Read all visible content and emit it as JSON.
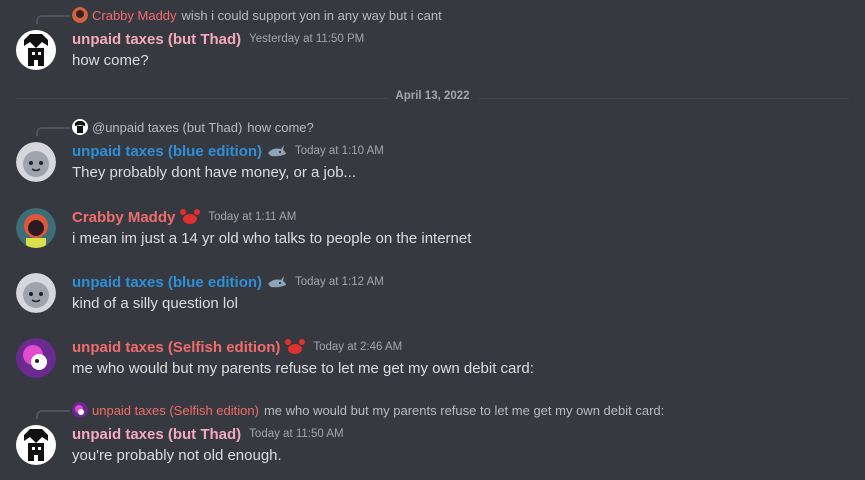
{
  "messages": [
    {
      "reply": {
        "author": "Crabby Maddy",
        "text": "wish i could support yon in any way but i cant"
      },
      "author": "unpaid taxes (but Thad)",
      "timestamp": "Yesterday at 11:50 PM",
      "content": "how come?"
    },
    {
      "reply": {
        "author": "@unpaid taxes (but Thad)",
        "text": "how come?"
      },
      "author": "unpaid taxes (blue edition)",
      "timestamp": "Today at 1:10 AM",
      "content": "They probably dont have money, or a job..."
    },
    {
      "author": "Crabby Maddy",
      "timestamp": "Today at 1:11 AM",
      "content": "i mean im just a 14 yr old who talks to people on the internet"
    },
    {
      "author": "unpaid taxes (blue edition)",
      "timestamp": "Today at 1:12 AM",
      "content": "kind of a silly question lol"
    },
    {
      "author": "unpaid taxes (Selfish edition)",
      "timestamp": "Today at 2:46 AM",
      "content": "me who would but my parents refuse to let me get my own debit card:"
    },
    {
      "reply": {
        "author": "unpaid taxes (Selfish edition)",
        "text": "me who would but my parents refuse to let me get my own debit card:"
      },
      "author": "unpaid taxes (but Thad)",
      "timestamp": "Today at 11:50 AM",
      "content": "you're probably not old enough."
    }
  ],
  "divider": {
    "label": "April 13, 2022"
  },
  "colors": {
    "background": "#36393f",
    "thad_pink": "#f5a9c0",
    "blue_edition": "#2e8fd8",
    "maddy_red": "#f06c6c",
    "selfish_red": "#f06c6c"
  },
  "icons": [
    "shark-emoji",
    "crab-emoji",
    "reply-spine"
  ]
}
